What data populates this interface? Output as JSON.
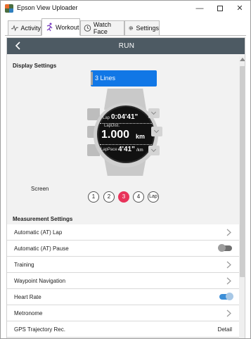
{
  "window": {
    "title": "Epson View Uploader",
    "min_symbol": "—",
    "close_symbol": "✕"
  },
  "tabs": [
    {
      "label": "Activity",
      "icon": "activity-icon",
      "active": false
    },
    {
      "label": "Workout",
      "icon": "runner-icon",
      "active": true
    },
    {
      "label": "Watch Face",
      "icon": "watch-face-icon",
      "active": false
    },
    {
      "label": "Settings",
      "icon": "gear-icon",
      "active": false
    }
  ],
  "header": {
    "title": "RUN",
    "back_icon": "back-arrow-icon"
  },
  "display_settings": {
    "title": "Display Settings",
    "lines_selected": "3 Lines",
    "watch": {
      "row1_label": "Lap",
      "row1_value": "0:04'41\"",
      "row2_label": "LapDist.",
      "row2_value": "1.000",
      "row2_unit": "km",
      "row3_label": "LapPace",
      "row3_value": "4'41\"",
      "row3_unit": "/km"
    },
    "screen_label": "Screen",
    "screens": [
      "1",
      "2",
      "3",
      "4",
      "Lap"
    ],
    "active_screen": "3"
  },
  "measurement_settings": {
    "title": "Measurement Settings",
    "items": [
      {
        "label": "Automatic (AT) Lap",
        "control": "chevron"
      },
      {
        "label": "Automatic (AT) Pause",
        "control": "toggle",
        "on": false
      },
      {
        "label": "Training",
        "control": "chevron"
      },
      {
        "label": "Waypoint Navigation",
        "control": "chevron"
      },
      {
        "label": "Heart Rate",
        "control": "toggle",
        "on": true
      },
      {
        "label": "Metronome",
        "control": "chevron"
      },
      {
        "label": "GPS Trajectory Rec.",
        "control": "text",
        "value": "Detail"
      }
    ]
  },
  "colors": {
    "header_bg": "#4d5a63",
    "accent_blue": "#1177e6",
    "active_screen": "#e8335a",
    "toggle_on": "#3c8fd8"
  }
}
